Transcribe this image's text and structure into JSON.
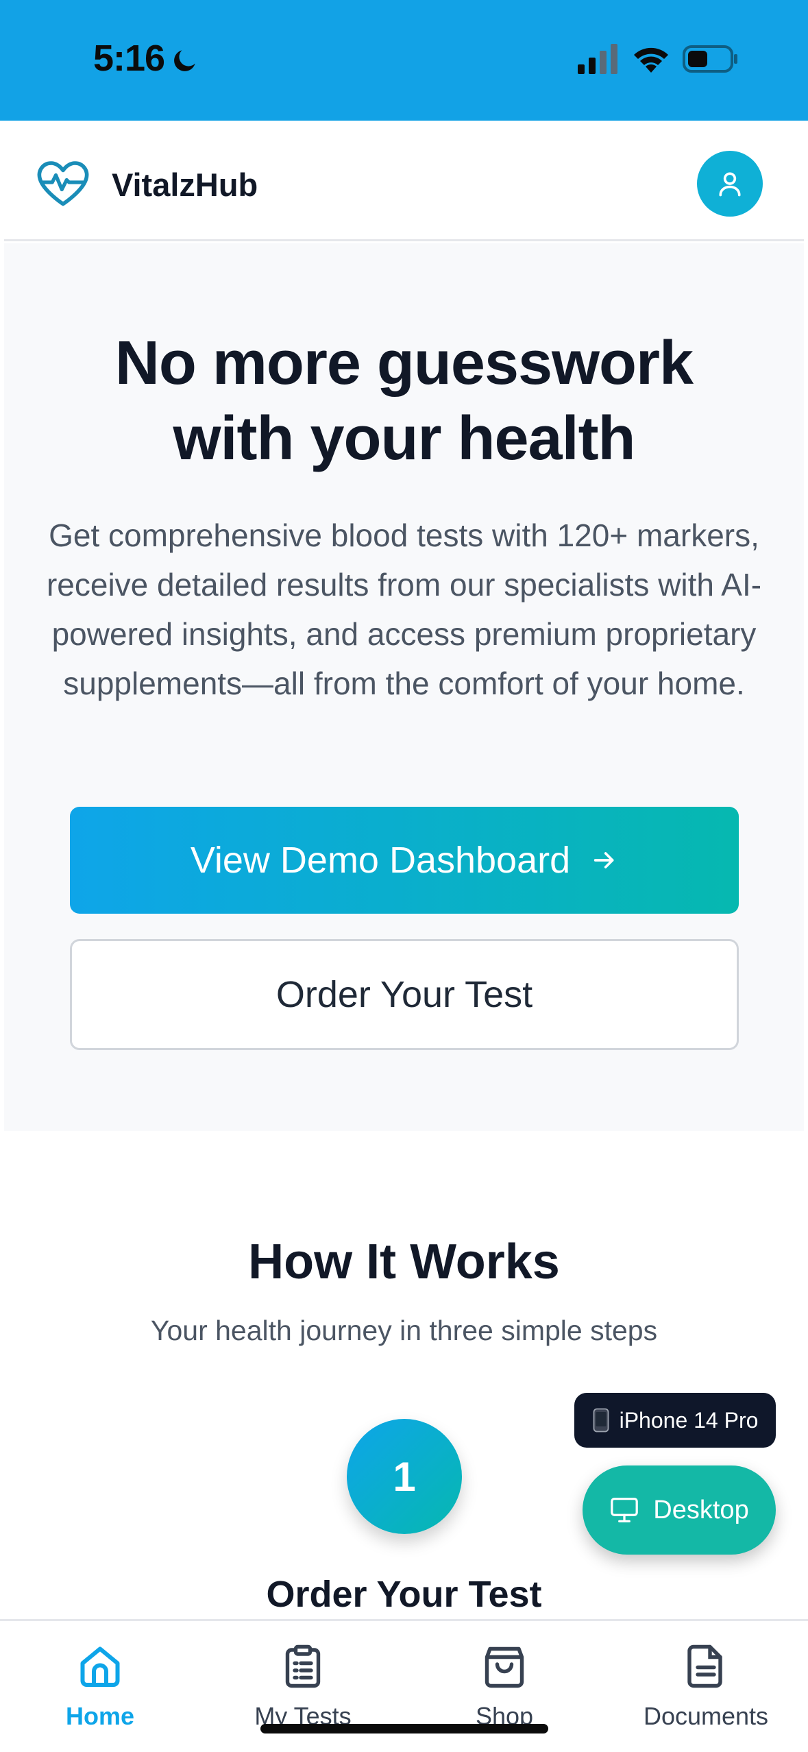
{
  "status_bar": {
    "time": "5:16",
    "background_color": "#12a2e6",
    "icons": [
      "moon-icon",
      "signal-icon",
      "wifi-icon",
      "battery-icon"
    ]
  },
  "header": {
    "brand": "VitalzHub",
    "logo_icon": "heart-pulse-icon",
    "avatar_icon": "user-icon",
    "accent_color": "#0fb0d6"
  },
  "hero": {
    "title_line1": "No more guesswork",
    "title_line2": "with your health",
    "description": "Get comprehensive blood tests with 120+ markers, receive detailed results from our specialists with AI-powered insights, and access premium proprietary supplements—all from the comfort of your home.",
    "primary_button": "View Demo Dashboard",
    "primary_button_icon": "arrow-right-icon",
    "secondary_button": "Order Your Test"
  },
  "how_it_works": {
    "title": "How It Works",
    "subtitle": "Your health journey in three simple steps",
    "steps": [
      {
        "number": "1",
        "title": "Order Your Test"
      }
    ]
  },
  "device_switcher": {
    "current_device": "iPhone 14 Pro",
    "current_device_icon": "phone-icon",
    "switch_button": "Desktop",
    "switch_button_icon": "monitor-icon"
  },
  "bottom_nav": {
    "items": [
      {
        "label": "Home",
        "icon": "home-icon",
        "active": true
      },
      {
        "label": "My Tests",
        "icon": "clipboard-list-icon",
        "active": false
      },
      {
        "label": "Shop",
        "icon": "shopping-bag-icon",
        "active": false
      },
      {
        "label": "Documents",
        "icon": "document-icon",
        "active": false
      }
    ],
    "active_color": "#0ea5e9"
  }
}
